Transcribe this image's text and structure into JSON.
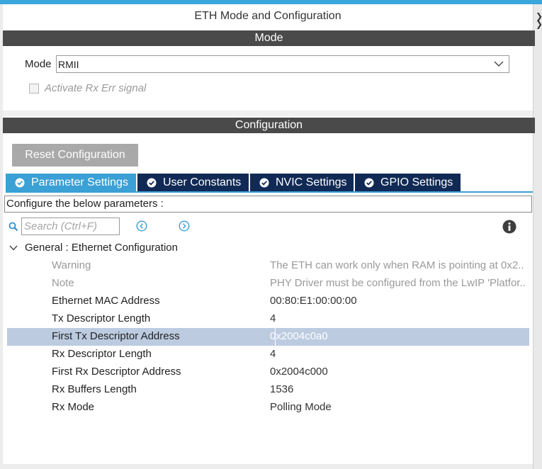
{
  "window": {
    "title": "ETH Mode and Configuration"
  },
  "mode_section": {
    "header": "Mode",
    "mode_label": "Mode",
    "mode_value": "RMII",
    "activate_rx_err_label": "Activate Rx Err signal",
    "activate_rx_err_checked": false
  },
  "config_section": {
    "header": "Configuration",
    "reset_button": "Reset Configuration",
    "tabs": [
      {
        "label": "Parameter Settings",
        "active": true
      },
      {
        "label": "User Constants",
        "active": false
      },
      {
        "label": "NVIC Settings",
        "active": false
      },
      {
        "label": "GPIO Settings",
        "active": false
      }
    ],
    "info_text": "Configure the below parameters :",
    "search_placeholder": "Search (Ctrl+F)",
    "group_label": "General : Ethernet Configuration",
    "params": [
      {
        "name": "Warning",
        "value": "The ETH can work only when RAM is pointing at 0x2..",
        "muted": true,
        "selected": false
      },
      {
        "name": "Note",
        "value": "PHY Driver must be configured from the LwIP 'Platfor..",
        "muted": true,
        "selected": false
      },
      {
        "name": "Ethernet MAC Address",
        "value": "00:80:E1:00:00:00",
        "muted": false,
        "selected": false
      },
      {
        "name": "Tx Descriptor Length",
        "value": "4",
        "muted": false,
        "selected": false
      },
      {
        "name": "First Tx Descriptor Address",
        "value": "0x2004c0a0",
        "muted": false,
        "selected": true
      },
      {
        "name": "Rx Descriptor Length",
        "value": "4",
        "muted": false,
        "selected": false
      },
      {
        "name": "First Rx Descriptor Address",
        "value": "0x2004c000",
        "muted": false,
        "selected": false
      },
      {
        "name": "Rx Buffers Length",
        "value": "1536",
        "muted": false,
        "selected": false
      },
      {
        "name": "Rx Mode",
        "value": "Polling Mode",
        "muted": false,
        "selected": false
      }
    ]
  },
  "icons": {
    "tab_check": "check-circle-icon",
    "search": "search-icon",
    "prev": "previous-icon",
    "next": "next-icon",
    "help": "info-icon",
    "group": "chevron-down-icon",
    "dropdown": "chevron-down-icon"
  },
  "colors": {
    "accent": "#3aa0d5",
    "tab_inactive": "#112a55",
    "section_header": "#4a4a4a",
    "selected_row": "#bccbe0",
    "muted_text": "#9a9a9a"
  }
}
